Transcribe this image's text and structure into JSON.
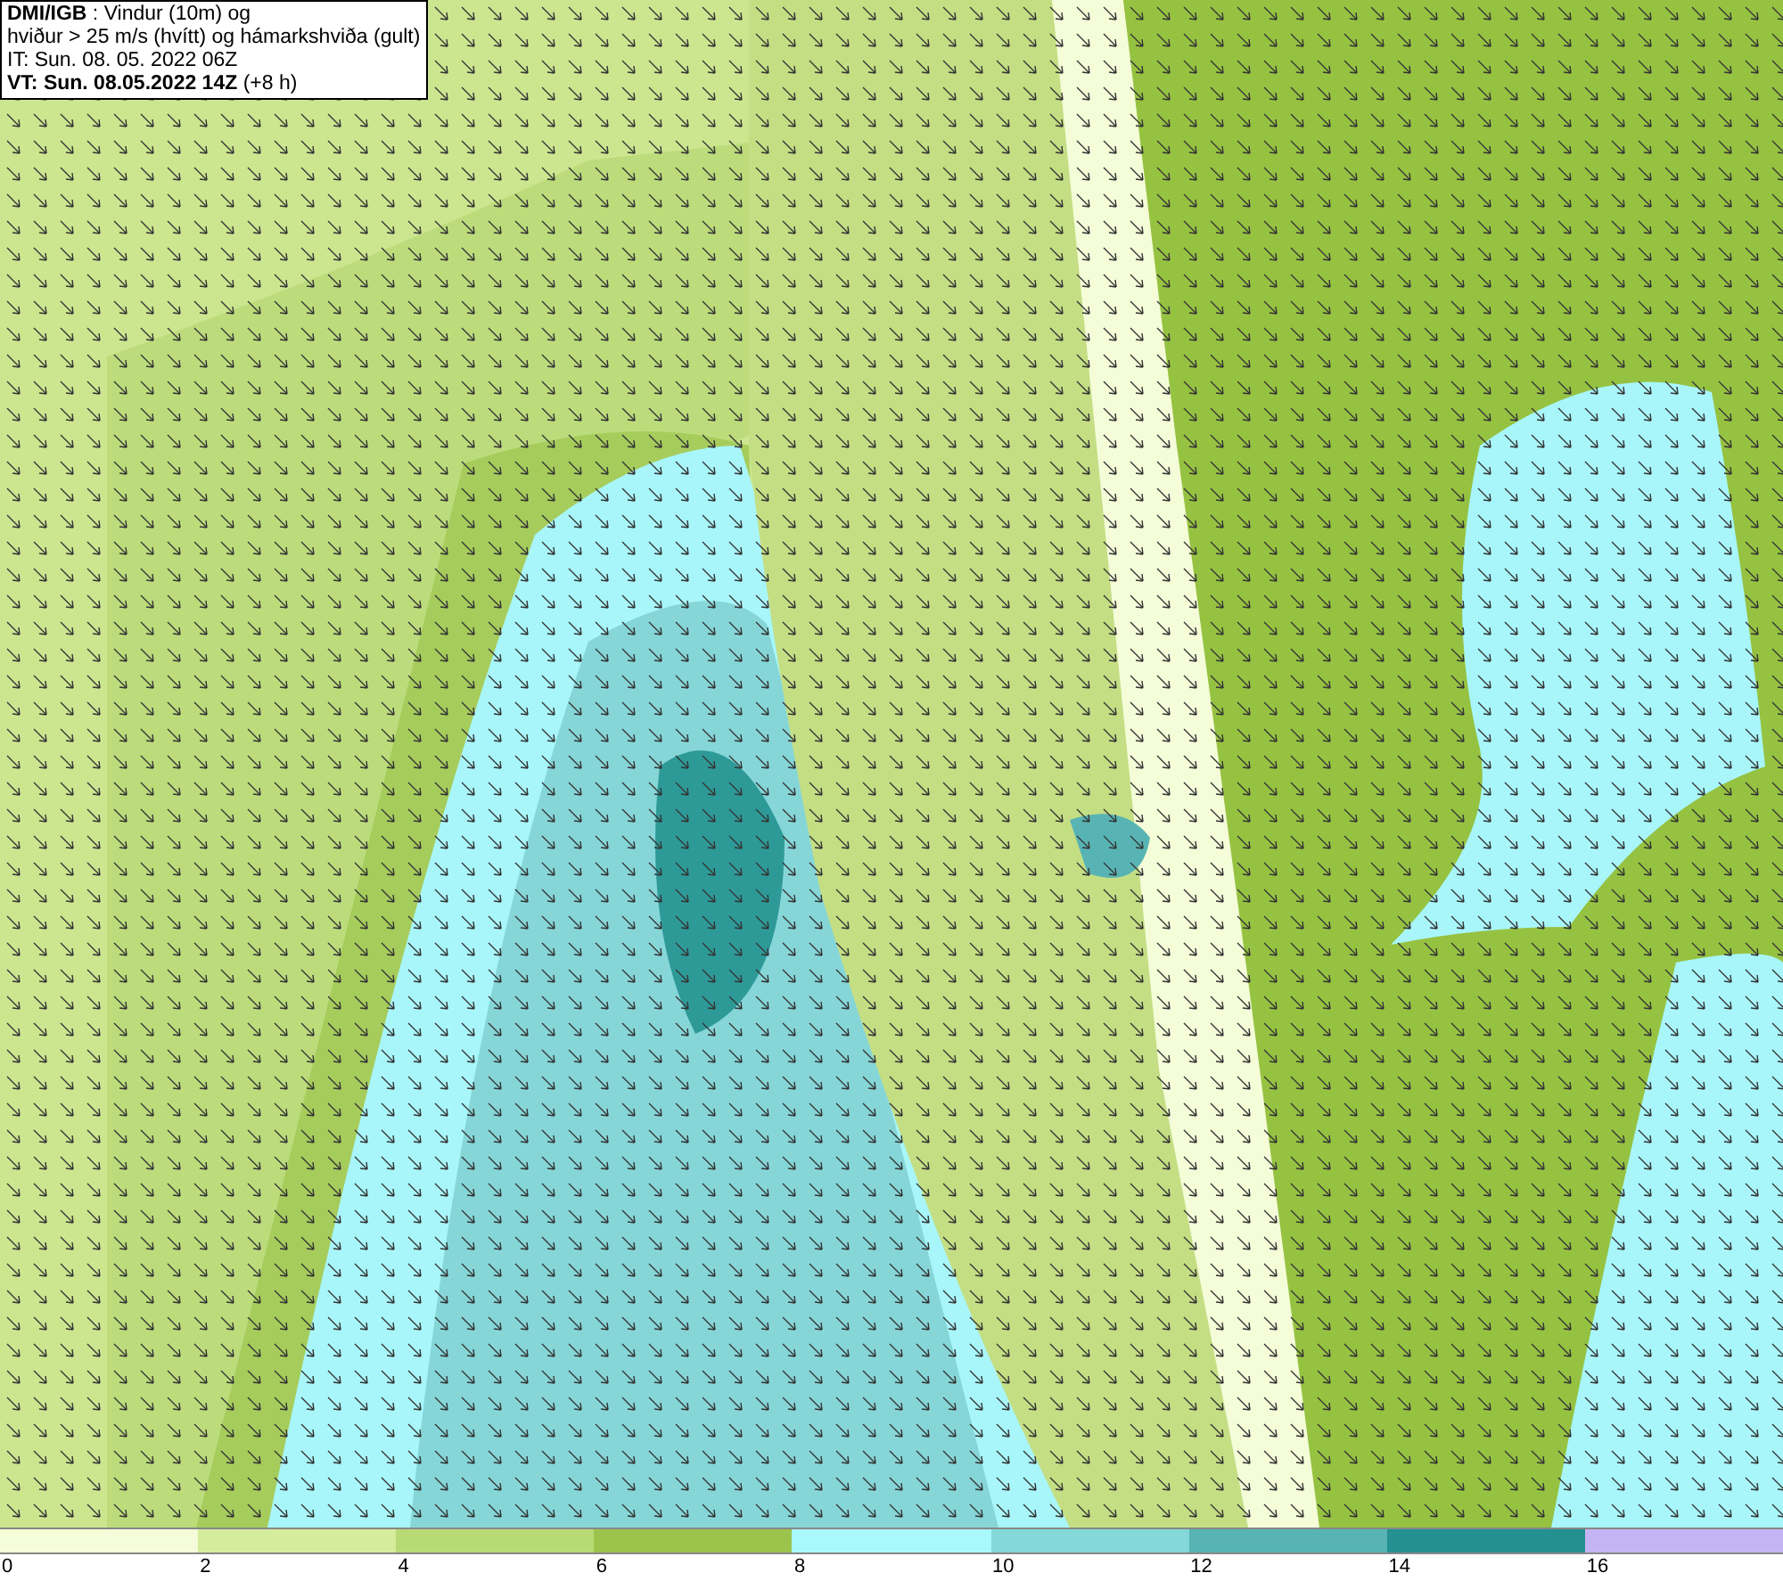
{
  "legend_box": {
    "lines": [
      "**DMI/IGB** : Vindur (10m) og",
      "hviður > 25 m/s (hvítt) og hámarkshviða (gult)",
      "IT: Sun. 08. 05. 2022 06Z",
      "**VT: Sun. 08.05.2022 14Z** (+8 h)"
    ]
  },
  "colorbar": {
    "segments": [
      {
        "label": "0",
        "color": "#f4fcd8"
      },
      {
        "label": "2",
        "color": "#d4ec9c"
      },
      {
        "label": "4",
        "color": "#b8da74"
      },
      {
        "label": "6",
        "color": "#9cc44c"
      },
      {
        "label": "8",
        "color": "#a8f8fc"
      },
      {
        "label": "10",
        "color": "#84d8d8"
      },
      {
        "label": "12",
        "color": "#58b4b4"
      },
      {
        "label": "14",
        "color": "#249090"
      },
      {
        "label": "16",
        "color": "#c4b4f4"
      }
    ]
  }
}
